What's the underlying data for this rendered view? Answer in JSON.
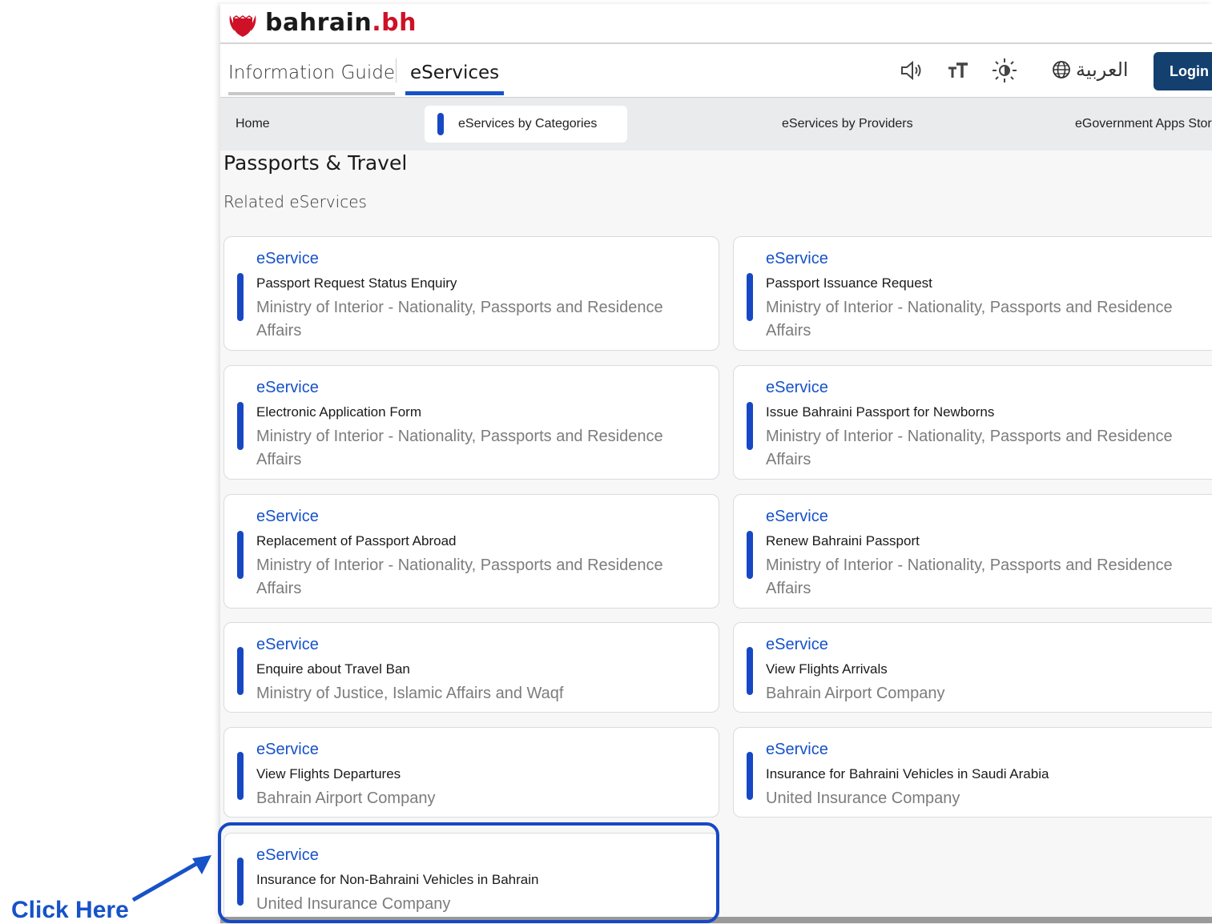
{
  "site": {
    "logo_main": "bahrain",
    "logo_accent": ".bh"
  },
  "nav": {
    "tabs": [
      {
        "label": "Information Guide"
      },
      {
        "label": "eServices"
      }
    ],
    "tools": [
      "speaker-icon",
      "text-size-icon",
      "brightness-icon"
    ],
    "language_label": "العربية",
    "login_label": "Login"
  },
  "subnav": {
    "items": [
      {
        "label": "Home"
      },
      {
        "label": "eServices by Categories"
      },
      {
        "label": "eServices by Providers"
      },
      {
        "label": "eGovernment Apps Store"
      }
    ]
  },
  "page": {
    "title": "Passports & Travel",
    "subtitle": "Related eServices"
  },
  "services": [
    {
      "kind": "eService",
      "name": "Passport Request Status Enquiry",
      "provider": "Ministry of Interior - Nationality, Passports and Residence Affairs"
    },
    {
      "kind": "eService",
      "name": "Passport Issuance Request",
      "provider": "Ministry of Interior - Nationality, Passports and Residence Affairs"
    },
    {
      "kind": "eService",
      "name": "Electronic Application Form",
      "provider": "Ministry of Interior - Nationality, Passports and Residence Affairs"
    },
    {
      "kind": "eService",
      "name": "Issue Bahraini Passport for Newborns",
      "provider": "Ministry of Interior - Nationality, Passports and Residence Affairs"
    },
    {
      "kind": "eService",
      "name": "Replacement of Passport Abroad",
      "provider": "Ministry of Interior - Nationality, Passports and Residence Affairs"
    },
    {
      "kind": "eService",
      "name": "Renew Bahraini Passport",
      "provider": "Ministry of Interior - Nationality, Passports and Residence Affairs"
    },
    {
      "kind": "eService",
      "name": "Enquire about Travel Ban",
      "provider": "Ministry of Justice, Islamic Affairs and Waqf"
    },
    {
      "kind": "eService",
      "name": "View Flights Arrivals",
      "provider": "Bahrain Airport Company"
    },
    {
      "kind": "eService",
      "name": "View Flights Departures",
      "provider": "Bahrain Airport Company"
    },
    {
      "kind": "eService",
      "name": "Insurance for Bahraini Vehicles in Saudi Arabia",
      "provider": "United Insurance Company"
    },
    {
      "kind": "eService",
      "name": "Insurance for Non-Bahraini Vehicles in Bahrain",
      "provider": "United Insurance Company"
    }
  ],
  "annotation": {
    "label": "Click Here"
  },
  "colors": {
    "accent_blue": "#1748c4",
    "login_bg": "#13406f",
    "logo_red": "#ce1126"
  }
}
